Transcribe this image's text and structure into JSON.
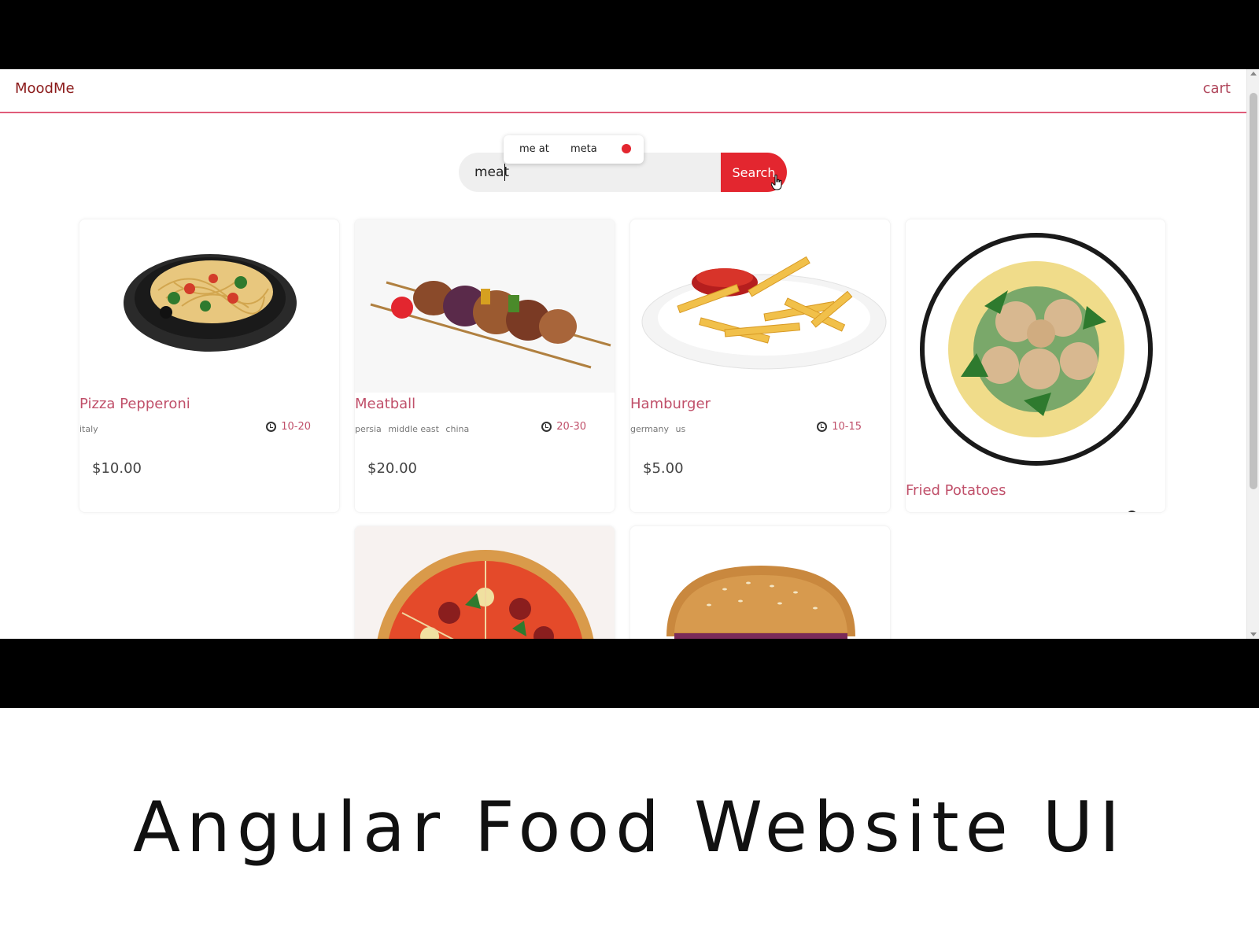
{
  "app": {
    "brand": "MoodMe",
    "cart_label": "cart",
    "accent_color": "#e3262f",
    "brand_color": "#8b1a1a",
    "header_border_color": "#e05c7a"
  },
  "search": {
    "value": "meat",
    "button_label": "Search",
    "suggestions": [
      "me at",
      "meta"
    ]
  },
  "foods": [
    {
      "name": "Pizza Pepperoni",
      "origins": [
        "italy"
      ],
      "cook_time": "10-20",
      "price": "$10.00",
      "image": "spaghetti-plate"
    },
    {
      "name": "Meatball",
      "origins": [
        "persia",
        "middle east",
        "china"
      ],
      "cook_time": "20-30",
      "price": "$20.00",
      "image": "kebab-skewer"
    },
    {
      "name": "Hamburger",
      "origins": [
        "germany",
        "us"
      ],
      "cook_time": "10-15",
      "price": "$5.00",
      "image": "fries-plate"
    },
    {
      "name": "Fried Potatoes",
      "origins": [],
      "cook_time": "",
      "price": "",
      "image": "meatball-pasta-plate"
    },
    {
      "name": "",
      "origins": [],
      "cook_time": "",
      "price": "",
      "image": "pizza"
    },
    {
      "name": "",
      "origins": [],
      "cook_time": "",
      "price": "",
      "image": "burger"
    }
  ],
  "caption": "Angular Food Website UI"
}
